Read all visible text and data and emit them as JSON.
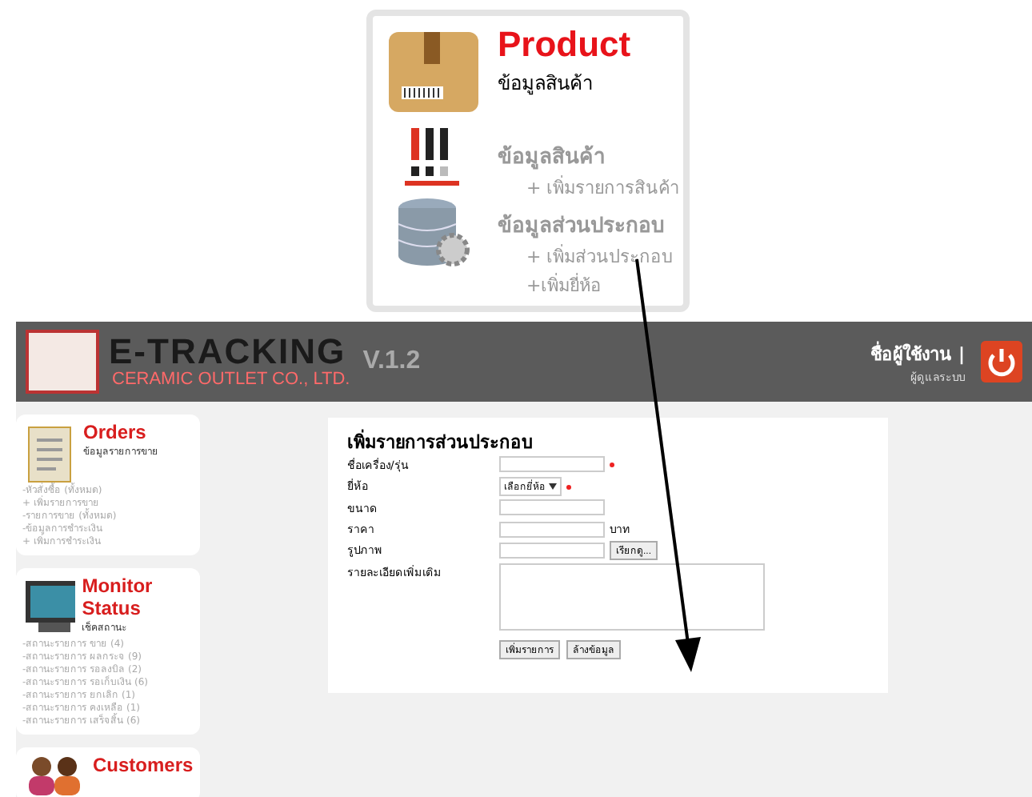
{
  "product_menu": {
    "title": "Product",
    "subtitle": "ข้อมูลสินค้า",
    "sections": [
      {
        "heading": "ข้อมูลสินค้า",
        "links": [
          "+ เพิ่มรายการสินค้า"
        ]
      },
      {
        "heading": "ข้อมูลส่วนประกอบ",
        "links": [
          "+ เพิ่มส่วนประกอบ",
          "+เพิ่มยี่ห้อ"
        ]
      }
    ]
  },
  "header": {
    "logo_title": "E-TRACKING",
    "version": "V.1.2",
    "company": "CERAMIC OUTLET CO., LTD.",
    "user_label": "ชื่อผู้ใช้งาน",
    "separator": "|",
    "role": "ผู้ดูแลระบบ"
  },
  "sidebar": [
    {
      "kind": "orders",
      "title": "Orders",
      "subtitle": "ข้อมูลรายการขาย",
      "items": [
        "-หัวสั่งซื้อ (ทั้งหมด)",
        "+ เพิ่มรายการขาย",
        "-รายการขาย (ทั้งหมด)",
        "-ข้อมูลการชำระเงิน",
        "+ เพิ่มการชำระเงิน"
      ]
    },
    {
      "kind": "monitor",
      "title": "Monitor Status",
      "subtitle": "เช็คสถานะ",
      "items": [
        "-สถานะรายการ ขาย (4)",
        "-สถานะรายการ ผลกระจ (9)",
        "-สถานะรายการ รอลงบิล (2)",
        "-สถานะรายการ รอเก็บเงิน (6)",
        "-สถานะรายการ ยกเลิก (1)",
        "-สถานะรายการ คงเหลือ (1)",
        "-สถานะรายการ เสร็จสิ้น (6)"
      ]
    },
    {
      "kind": "customers",
      "title": "Customers"
    }
  ],
  "form": {
    "title": "เพิ่มรายการส่วนประกอบ",
    "fields": [
      {
        "kind": "text",
        "label": "ชื่อเครื่อง/รุ่น",
        "required": true
      },
      {
        "kind": "select",
        "label": "ยี่ห้อ",
        "value": "เลือกยี่ห้อ",
        "required": true
      },
      {
        "kind": "text",
        "label": "ขนาด",
        "required": false
      },
      {
        "kind": "text",
        "label": "ราคา",
        "required": false,
        "unit": "บาท"
      },
      {
        "kind": "file",
        "label": "รูปภาพ",
        "required": false,
        "button": "เรียกดู..."
      },
      {
        "kind": "textarea",
        "label": "รายละเอียดเพิ่มเติม",
        "required": false
      }
    ],
    "buttons": [
      "เพิ่มรายการ",
      "ล้างข้อมูล"
    ]
  }
}
